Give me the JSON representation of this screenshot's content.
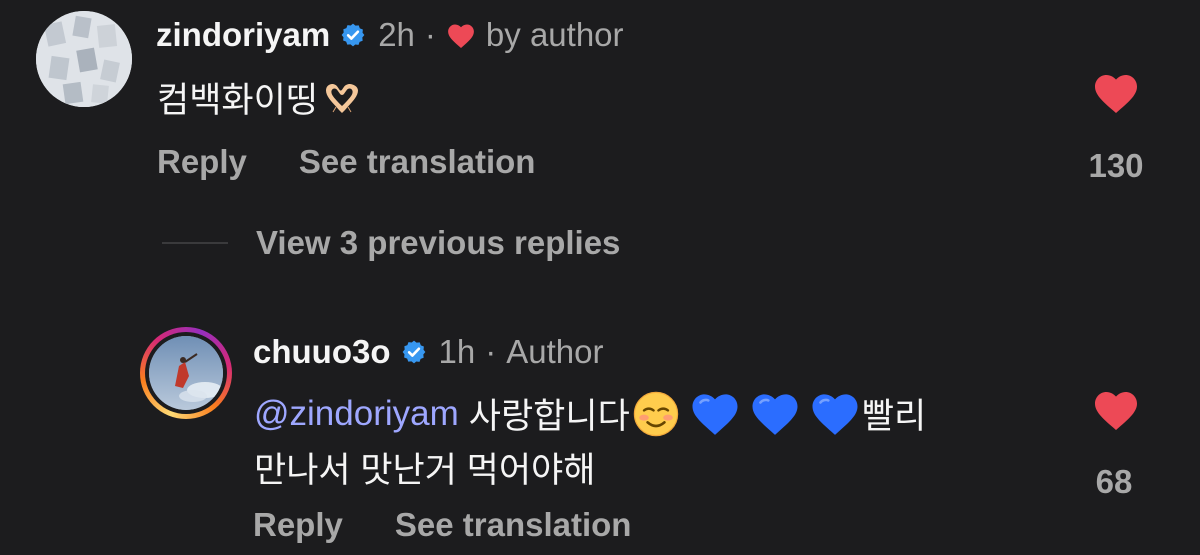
{
  "comment1": {
    "username": "zindoriyam",
    "time": "2h",
    "liked_by_author_text": "by author",
    "text": "컴백화이띵",
    "emoji_name": "heart-hands",
    "reply_label": "Reply",
    "translate_label": "See translation",
    "like_count": "130"
  },
  "view_replies": {
    "label": "View 3 previous replies"
  },
  "comment2": {
    "username": "chuuo3o",
    "time": "1h",
    "author_badge": "Author",
    "mention": "@zindoriyam",
    "text_part1": "사랑합니다",
    "text_part2": "빨리",
    "text_line2": "만나서 맛난거 먹어야해",
    "emojis": [
      "smiling-face-icon",
      "blue-heart-icon",
      "blue-heart-icon",
      "blue-heart-icon"
    ],
    "reply_label": "Reply",
    "translate_label": "See translation",
    "like_count": "68"
  },
  "colors": {
    "background": "#1c1c1e",
    "text": "#f5f5f5",
    "muted": "#a8a8a8",
    "heart_red": "#ed4956",
    "verified_blue": "#3797f0",
    "mention": "#9ea7ff",
    "blue_heart": "#2b6dff"
  }
}
